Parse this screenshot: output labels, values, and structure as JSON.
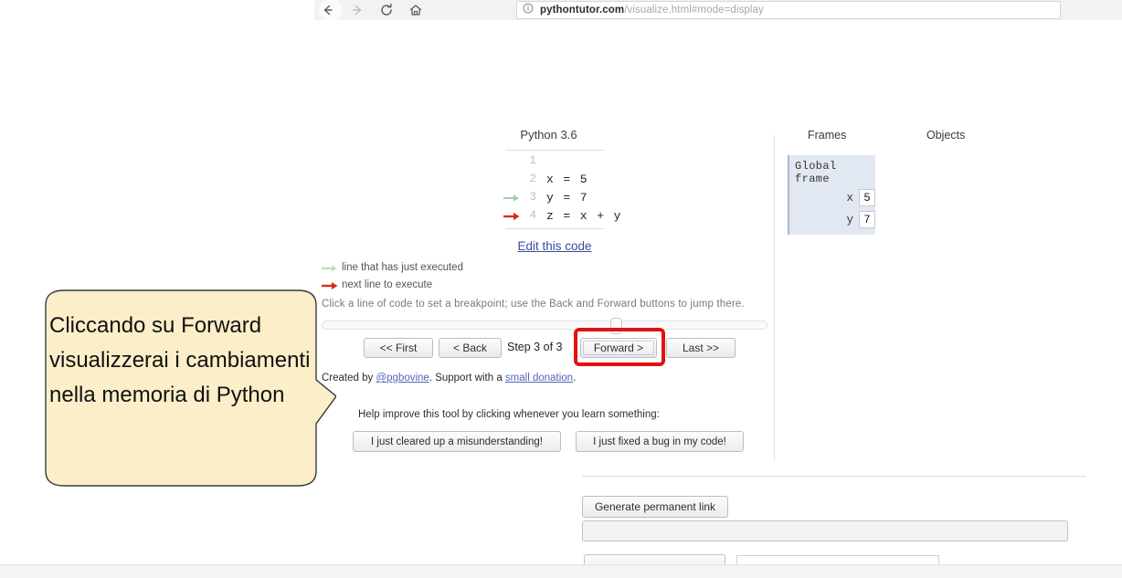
{
  "browser": {
    "back_icon": "back-arrow-icon",
    "forward_icon": "forward-arrow-icon",
    "reload_icon": "reload-icon",
    "home_icon": "home-icon",
    "info_icon": "info-circle-icon",
    "reader_icon": "reader-view-icon",
    "url_domain": "pythontutor.com",
    "url_path": "/visualize.html#mode=display"
  },
  "code_panel": {
    "python_version": "Python 3.6",
    "lines": [
      {
        "num": "1",
        "text": "",
        "marker": "none"
      },
      {
        "num": "2",
        "text": "x = 5",
        "marker": "none"
      },
      {
        "num": "3",
        "text": "y = 7",
        "marker": "green"
      },
      {
        "num": "4",
        "text": "z = x + y",
        "marker": "red"
      }
    ],
    "edit_link": "Edit this code"
  },
  "legend": {
    "green_label": "line that has just executed",
    "red_label": "next line to execute",
    "breakpoint_hint": "Click a line of code to set a breakpoint; use the Back and Forward buttons to jump there."
  },
  "controls": {
    "first_label": "<< First",
    "back_label": "< Back",
    "step_label": "Step 3 of 3",
    "forward_label": "Forward >",
    "last_label": "Last >>",
    "highlight_color": "#e11212",
    "slider_position_pct": 65
  },
  "credits": {
    "prefix": "Created by ",
    "author_link": "@pgbovine",
    "middle": ". Support with a ",
    "donation_link": "small donation",
    "suffix": "."
  },
  "feedback": {
    "prompt": "Help improve this tool by clicking whenever you learn something:",
    "button_1": "I just cleared up a misunderstanding!",
    "button_2": "I just fixed a bug in my code!"
  },
  "visualization": {
    "frames_header": "Frames",
    "objects_header": "Objects",
    "global_frame_title": "Global frame",
    "variables": [
      {
        "name": "x",
        "value": "5"
      },
      {
        "name": "y",
        "value": "7"
      }
    ]
  },
  "permalink": {
    "button_label": "Generate permanent link",
    "input_value": "",
    "input_placeholder": ""
  },
  "callout": {
    "text": "Cliccando su Forward visualizzerai i cambiamenti nella memoria di Python",
    "fill_color": "#fbeec8",
    "border_color": "#3a3a3a"
  }
}
